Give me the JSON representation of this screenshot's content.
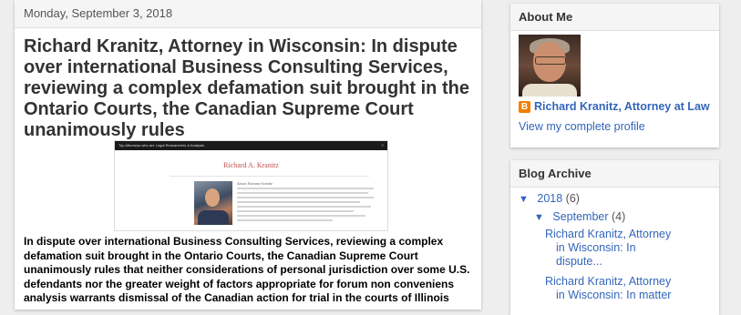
{
  "post": {
    "date": "Monday, September 3, 2018",
    "title": "Richard Kranitz, Attorney in Wisconsin: In dispute over international Business Consulting Services, reviewing a complex defamation suit brought in the Ontario Courts, the Canadian Supreme Court unanimously rules",
    "embedded_screenshot": {
      "top_bar_text": "Top Attorneys who are Legal Researchers & Analysts",
      "name": "Richard A. Kranitz",
      "section_heading": "About Richard Kranitz"
    },
    "body": "In dispute over international Business Consulting Services, reviewing a complex defamation suit brought in the Ontario Courts, the Canadian Supreme Court unanimously rules that neither considerations of personal jurisdiction over some U.S. defendants nor the greater weight of factors appropriate for forum non conveniens analysis warrants dismissal of the Canadian action for trial in the courts of Illinois"
  },
  "about": {
    "title": "About Me",
    "profile_name": "Richard Kranitz, Attorney at Law",
    "profile_link": "View my complete profile",
    "blogger_glyph": "B"
  },
  "archive": {
    "title": "Blog Archive",
    "year_toggle": "▼",
    "year": "2018",
    "year_count": "(6)",
    "month_toggle": "▼",
    "month": "September",
    "month_count": "(4)",
    "posts": [
      {
        "line1": "Richard Kranitz, Attorney",
        "line2": "in Wisconsin: In",
        "line3": "dispute..."
      },
      {
        "line1": "Richard Kranitz, Attorney",
        "line2": "in Wisconsin: In matter"
      }
    ]
  }
}
